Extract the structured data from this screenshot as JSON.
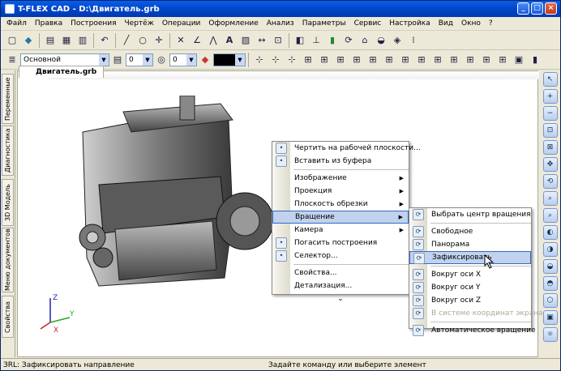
{
  "window": {
    "title": "T-FLEX CAD - D:\\Двигатель.grb"
  },
  "menubar": [
    "Файл",
    "Правка",
    "Построения",
    "Чертёж",
    "Операции",
    "Оформление",
    "Анализ",
    "Параметры",
    "Сервис",
    "Настройка",
    "Вид",
    "Окно",
    "?"
  ],
  "props": {
    "layer": "Основной",
    "val1": "0",
    "val2": "0"
  },
  "doc_tab": "Двигатель.grb",
  "side_tabs": [
    "Переменные",
    "Диагностика",
    "3D Модель",
    "Меню документов",
    "Свойства"
  ],
  "axes": {
    "x": "X",
    "y": "Y",
    "z": "Z"
  },
  "context_menu": [
    {
      "label": "Чертить на рабочей плоскости...",
      "icon": "pencil-icon"
    },
    {
      "label": "Вставить из буфера",
      "icon": "paste-icon"
    },
    {
      "label": "Изображение",
      "sub": true
    },
    {
      "label": "Проекция",
      "sub": true
    },
    {
      "label": "Плоскость обрезки",
      "sub": true
    },
    {
      "label": "Вращение",
      "sub": true,
      "highlight": true
    },
    {
      "label": "Камера",
      "sub": true
    },
    {
      "label": "Погасить построения",
      "icon": "hide-icon"
    },
    {
      "label": "Селектор...",
      "icon": "selector-icon"
    },
    {
      "label": "Свойства...",
      "icon": ""
    },
    {
      "label": "Детализация..."
    }
  ],
  "submenu": [
    {
      "label": "Выбрать центр вращения"
    },
    {
      "label": "Свободное"
    },
    {
      "label": "Панорама"
    },
    {
      "label": "Зафиксировать",
      "highlight": true
    },
    {
      "label": "Вокруг оси X"
    },
    {
      "label": "Вокруг оси Y"
    },
    {
      "label": "Вокруг оси Z"
    },
    {
      "label": "В системе координат экрана",
      "disabled": true
    },
    {
      "label": "Автоматическое вращение"
    }
  ],
  "status": {
    "left": "ЗRL: Зафиксировать направление",
    "center": "Задайте команду или выберите элемент"
  },
  "colors": {
    "accent": "#316ac5",
    "title": "#0046c8"
  }
}
